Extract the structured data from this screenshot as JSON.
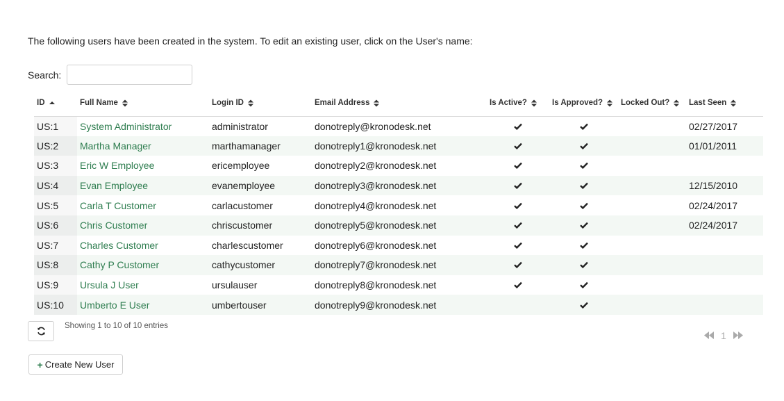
{
  "intro_text": "The following users have been created in the system. To edit an existing user, click on the User's name:",
  "search": {
    "label": "Search:",
    "value": "",
    "placeholder": ""
  },
  "columns": {
    "id": "ID",
    "full_name": "Full Name",
    "login_id": "Login ID",
    "email": "Email Address",
    "is_active": "Is Active?",
    "is_approved": "Is Approved?",
    "locked_out": "Locked Out?",
    "last_seen": "Last Seen"
  },
  "sort": {
    "column": "ID",
    "direction": "ascending"
  },
  "rows": [
    {
      "id": "US:1",
      "name": "System Administrator",
      "login": "administrator",
      "email": "donotreply@kronodesk.net",
      "active": true,
      "approved": true,
      "locked": false,
      "last_seen": "02/27/2017"
    },
    {
      "id": "US:2",
      "name": "Martha Manager",
      "login": "marthamanager",
      "email": "donotreply1@kronodesk.net",
      "active": true,
      "approved": true,
      "locked": false,
      "last_seen": "01/01/2011"
    },
    {
      "id": "US:3",
      "name": "Eric W Employee",
      "login": "ericemployee",
      "email": "donotreply2@kronodesk.net",
      "active": true,
      "approved": true,
      "locked": false,
      "last_seen": ""
    },
    {
      "id": "US:4",
      "name": "Evan Employee",
      "login": "evanemployee",
      "email": "donotreply3@kronodesk.net",
      "active": true,
      "approved": true,
      "locked": false,
      "last_seen": "12/15/2010"
    },
    {
      "id": "US:5",
      "name": "Carla T Customer",
      "login": "carlacustomer",
      "email": "donotreply4@kronodesk.net",
      "active": true,
      "approved": true,
      "locked": false,
      "last_seen": "02/24/2017"
    },
    {
      "id": "US:6",
      "name": "Chris Customer",
      "login": "chriscustomer",
      "email": "donotreply5@kronodesk.net",
      "active": true,
      "approved": true,
      "locked": false,
      "last_seen": "02/24/2017"
    },
    {
      "id": "US:7",
      "name": "Charles Customer",
      "login": "charlescustomer",
      "email": "donotreply6@kronodesk.net",
      "active": true,
      "approved": true,
      "locked": false,
      "last_seen": ""
    },
    {
      "id": "US:8",
      "name": "Cathy P Customer",
      "login": "cathycustomer",
      "email": "donotreply7@kronodesk.net",
      "active": true,
      "approved": true,
      "locked": false,
      "last_seen": ""
    },
    {
      "id": "US:9",
      "name": "Ursula J User",
      "login": "ursulauser",
      "email": "donotreply8@kronodesk.net",
      "active": true,
      "approved": true,
      "locked": false,
      "last_seen": ""
    },
    {
      "id": "US:10",
      "name": "Umberto E User",
      "login": "umbertouser",
      "email": "donotreply9@kronodesk.net",
      "active": false,
      "approved": true,
      "locked": false,
      "last_seen": ""
    }
  ],
  "info_text": "Showing 1 to 10 of 10 entries",
  "pager": {
    "current_page": "1"
  },
  "buttons": {
    "refresh": "refresh-icon",
    "create_new_user": "Create New User"
  },
  "colors": {
    "link": "#2e7d4f",
    "row_alt": "#f3f8f4"
  }
}
